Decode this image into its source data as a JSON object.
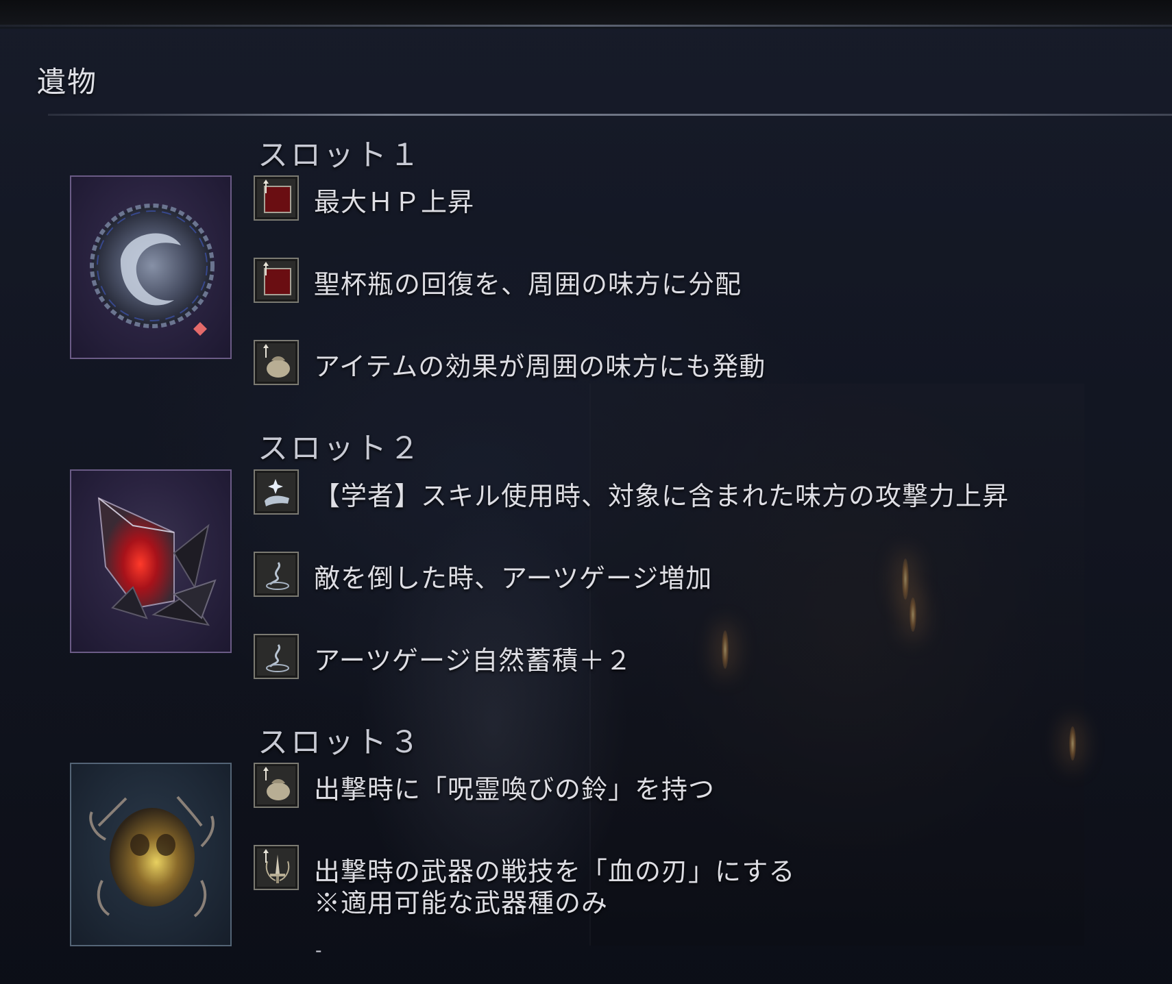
{
  "screen_title": "遺物",
  "slots": [
    {
      "header": "スロット１",
      "relic_icon": "chained-moon-relic-icon",
      "effects": [
        {
          "icon": "red-square-stat-icon",
          "text": "最大ＨＰ上昇"
        },
        {
          "icon": "red-square-stat-icon",
          "text": "聖杯瓶の回復を、周囲の味方に分配"
        },
        {
          "icon": "item-pouch-icon",
          "text": "アイテムの効果が周囲の味方にも発動"
        }
      ]
    },
    {
      "header": "スロット２",
      "relic_icon": "red-crystal-relic-icon",
      "effects": [
        {
          "icon": "skill-hand-icon",
          "text": "【学者】スキル使用時、対象に含まれた味方の攻撃力上昇"
        },
        {
          "icon": "arts-swirl-icon",
          "text": "敵を倒した時、アーツゲージ増加"
        },
        {
          "icon": "arts-swirl-icon",
          "text": "アーツゲージ自然蓄積＋２"
        }
      ]
    },
    {
      "header": "スロット３",
      "relic_icon": "amber-skull-relic-icon",
      "effects": [
        {
          "icon": "item-pouch-icon",
          "text": "出撃時に「呪霊喚びの鈴」を持つ"
        },
        {
          "icon": "blade-skill-icon",
          "text": "出撃時の武器の戦技を「血の刃」にする",
          "note": "※適用可能な武器種のみ"
        }
      ]
    }
  ],
  "trailing_mark": "-"
}
